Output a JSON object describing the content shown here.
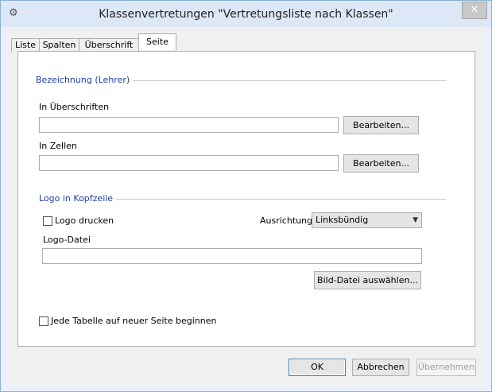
{
  "window": {
    "title": "Klassenvertretungen \"Vertretungsliste nach Klassen\"",
    "close_label": "✕"
  },
  "tabs": [
    {
      "label": "Liste",
      "active": false
    },
    {
      "label": "Spalten",
      "active": false
    },
    {
      "label": "Überschrift",
      "active": false
    },
    {
      "label": "Seite",
      "active": true
    }
  ],
  "bezeichnung": {
    "group_title": "Bezeichnung (Lehrer)",
    "ueberschriften_label": "In Überschriften",
    "ueberschriften_value": "",
    "ueberschriften_button": "Bearbeiten...",
    "zellen_label": "In Zellen",
    "zellen_value": "",
    "zellen_button": "Bearbeiten..."
  },
  "logo": {
    "group_title": "Logo in Kopfzeile",
    "print_label": "Logo drucken",
    "print_checked": false,
    "alignment_label": "Ausrichtung",
    "alignment_value": "Linksbündig",
    "file_label": "Logo-Datei",
    "file_value": "",
    "choose_button": "Bild-Datei auswählen..."
  },
  "new_page": {
    "label": "Jede Tabelle auf neuer Seite beginnen",
    "checked": false
  },
  "footer": {
    "ok": "OK",
    "cancel": "Abbrechen",
    "apply": "Übernehmen"
  }
}
